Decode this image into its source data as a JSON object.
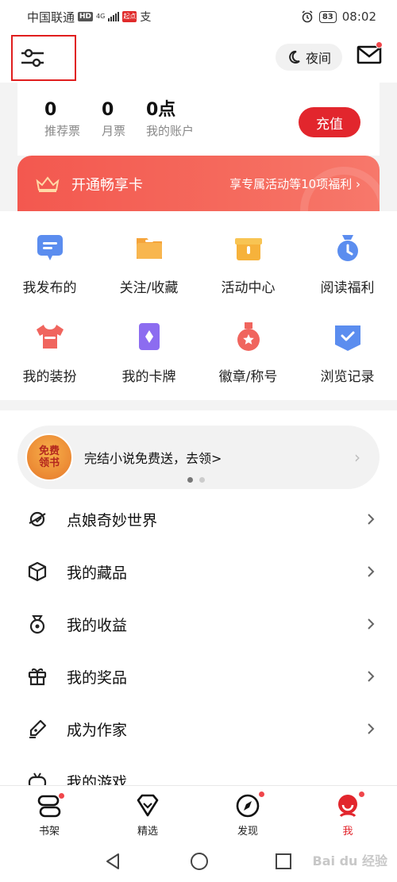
{
  "status_bar": {
    "carrier": "中国联通",
    "hd": "HD",
    "network": "4G",
    "app_badge": "起点",
    "pay_glyph": "支",
    "battery": "83",
    "time": "08:02"
  },
  "header": {
    "night_label": "夜间"
  },
  "account": {
    "stats": [
      {
        "value": "0",
        "label": "推荐票"
      },
      {
        "value": "0",
        "label": "月票"
      },
      {
        "value": "0点",
        "label": "我的账户"
      }
    ],
    "recharge_label": "充值"
  },
  "vip": {
    "title": "开通畅享卡",
    "link": "享专属活动等10项福利 ›"
  },
  "grid": [
    {
      "label": "我发布的",
      "icon": "message-icon",
      "color": "#5b8def"
    },
    {
      "label": "关注/收藏",
      "icon": "folder-icon",
      "color": "#f5a43a"
    },
    {
      "label": "活动中心",
      "icon": "gift-box-icon",
      "color": "#f6b23b"
    },
    {
      "label": "阅读福利",
      "icon": "clock-bag-icon",
      "color": "#5b8def"
    },
    {
      "label": "我的装扮",
      "icon": "tshirt-icon",
      "color": "#f0655e"
    },
    {
      "label": "我的卡牌",
      "icon": "card-icon",
      "color": "#8c6cf0"
    },
    {
      "label": "徽章/称号",
      "icon": "medal-icon",
      "color": "#f0655e"
    },
    {
      "label": "浏览记录",
      "icon": "history-icon",
      "color": "#5b8def"
    }
  ],
  "promo": {
    "avatar_text_1": "免费",
    "avatar_text_2": "领书",
    "text": "完结小说免费送，去领>"
  },
  "menu": [
    {
      "label": "点娘奇妙世界",
      "icon": "planet-icon"
    },
    {
      "label": "我的藏品",
      "icon": "cube-icon"
    },
    {
      "label": "我的收益",
      "icon": "money-bag-icon"
    },
    {
      "label": "我的奖品",
      "icon": "prize-icon"
    },
    {
      "label": "成为作家",
      "icon": "pen-icon"
    },
    {
      "label": "我的游戏",
      "icon": "gamepad-icon"
    }
  ],
  "tabs": [
    {
      "label": "书架",
      "icon": "bookshelf-icon"
    },
    {
      "label": "精选",
      "icon": "diamond-icon"
    },
    {
      "label": "发现",
      "icon": "compass-icon"
    },
    {
      "label": "我",
      "icon": "profile-icon"
    }
  ],
  "colors": {
    "accent": "#e2262d",
    "vip_gradient_start": "#f3584f"
  },
  "watermark": "Bai du 经验"
}
